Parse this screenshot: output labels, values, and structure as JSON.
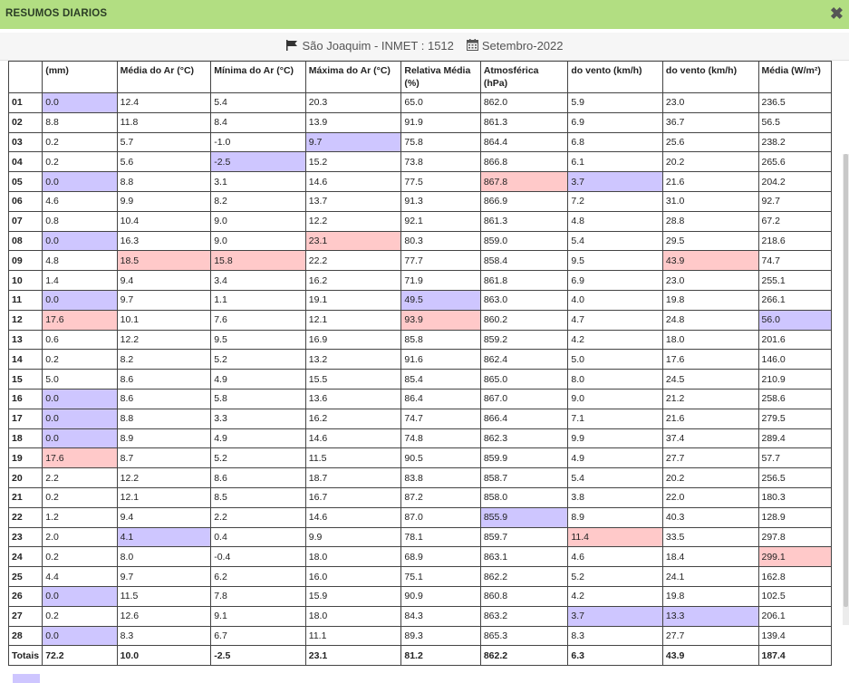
{
  "window": {
    "title": "RESUMOS DIARIOS",
    "close_icon": "close-icon"
  },
  "header": {
    "station": "São Joaquim - INMET : 1512",
    "period": "Setembro-2022",
    "station_icon": "flag-icon",
    "period_icon": "calendar-icon"
  },
  "colors": {
    "title_bar": "#b2de82",
    "min_highlight": "#cec6ff",
    "max_highlight": "#ffc9c9"
  },
  "table": {
    "columns": [
      "",
      "(mm)",
      "Média do Ar (°C)",
      "Mínima do Ar (°C)",
      "Máxima do Ar (°C)",
      "Relativa Média (%)",
      "Atmosférica (hPa)",
      "do vento (km/h)",
      "do vento (km/h)",
      "Média (W/m²)"
    ],
    "rows": [
      {
        "day": "01",
        "cells": [
          "0.0",
          "12.4",
          "5.4",
          "20.3",
          "65.0",
          "862.0",
          "5.9",
          "23.0",
          "236.5"
        ],
        "hl": [
          "min",
          "",
          "",
          "",
          "",
          "",
          "",
          "",
          ""
        ]
      },
      {
        "day": "02",
        "cells": [
          "8.8",
          "11.8",
          "8.4",
          "13.9",
          "91.9",
          "861.3",
          "6.9",
          "36.7",
          "56.5"
        ],
        "hl": [
          "",
          "",
          "",
          "",
          "",
          "",
          "",
          "",
          ""
        ]
      },
      {
        "day": "03",
        "cells": [
          "0.2",
          "5.7",
          "-1.0",
          "9.7",
          "75.8",
          "864.4",
          "6.8",
          "25.6",
          "238.2"
        ],
        "hl": [
          "",
          "",
          "",
          "min",
          "",
          "",
          "",
          "",
          ""
        ]
      },
      {
        "day": "04",
        "cells": [
          "0.2",
          "5.6",
          "-2.5",
          "15.2",
          "73.8",
          "866.8",
          "6.1",
          "20.2",
          "265.6"
        ],
        "hl": [
          "",
          "",
          "min",
          "",
          "",
          "",
          "",
          "",
          ""
        ]
      },
      {
        "day": "05",
        "cells": [
          "0.0",
          "8.8",
          "3.1",
          "14.6",
          "77.5",
          "867.8",
          "3.7",
          "21.6",
          "204.2"
        ],
        "hl": [
          "min",
          "",
          "",
          "",
          "",
          "max",
          "min",
          "",
          ""
        ]
      },
      {
        "day": "06",
        "cells": [
          "4.6",
          "9.9",
          "8.2",
          "13.7",
          "91.3",
          "866.9",
          "7.2",
          "31.0",
          "92.7"
        ],
        "hl": [
          "",
          "",
          "",
          "",
          "",
          "",
          "",
          "",
          ""
        ]
      },
      {
        "day": "07",
        "cells": [
          "0.8",
          "10.4",
          "9.0",
          "12.2",
          "92.1",
          "861.3",
          "4.8",
          "28.8",
          "67.2"
        ],
        "hl": [
          "",
          "",
          "",
          "",
          "",
          "",
          "",
          "",
          ""
        ]
      },
      {
        "day": "08",
        "cells": [
          "0.0",
          "16.3",
          "9.0",
          "23.1",
          "80.3",
          "859.0",
          "5.4",
          "29.5",
          "218.6"
        ],
        "hl": [
          "min",
          "",
          "",
          "max",
          "",
          "",
          "",
          "",
          ""
        ]
      },
      {
        "day": "09",
        "cells": [
          "4.8",
          "18.5",
          "15.8",
          "22.2",
          "77.7",
          "858.4",
          "9.5",
          "43.9",
          "74.7"
        ],
        "hl": [
          "",
          "max",
          "max",
          "",
          "",
          "",
          "",
          "max",
          ""
        ]
      },
      {
        "day": "10",
        "cells": [
          "1.4",
          "9.4",
          "3.4",
          "16.2",
          "71.9",
          "861.8",
          "6.9",
          "23.0",
          "255.1"
        ],
        "hl": [
          "",
          "",
          "",
          "",
          "",
          "",
          "",
          "",
          ""
        ]
      },
      {
        "day": "11",
        "cells": [
          "0.0",
          "9.7",
          "1.1",
          "19.1",
          "49.5",
          "863.0",
          "4.0",
          "19.8",
          "266.1"
        ],
        "hl": [
          "min",
          "",
          "",
          "",
          "min",
          "",
          "",
          "",
          ""
        ]
      },
      {
        "day": "12",
        "cells": [
          "17.6",
          "10.1",
          "7.6",
          "12.1",
          "93.9",
          "860.2",
          "4.7",
          "24.8",
          "56.0"
        ],
        "hl": [
          "max",
          "",
          "",
          "",
          "max",
          "",
          "",
          "",
          "min"
        ]
      },
      {
        "day": "13",
        "cells": [
          "0.6",
          "12.2",
          "9.5",
          "16.9",
          "85.8",
          "859.2",
          "4.2",
          "18.0",
          "201.6"
        ],
        "hl": [
          "",
          "",
          "",
          "",
          "",
          "",
          "",
          "",
          ""
        ]
      },
      {
        "day": "14",
        "cells": [
          "0.2",
          "8.2",
          "5.2",
          "13.2",
          "91.6",
          "862.4",
          "5.0",
          "17.6",
          "146.0"
        ],
        "hl": [
          "",
          "",
          "",
          "",
          "",
          "",
          "",
          "",
          ""
        ]
      },
      {
        "day": "15",
        "cells": [
          "5.0",
          "8.6",
          "4.9",
          "15.5",
          "85.4",
          "865.0",
          "8.0",
          "24.5",
          "210.9"
        ],
        "hl": [
          "",
          "",
          "",
          "",
          "",
          "",
          "",
          "",
          ""
        ]
      },
      {
        "day": "16",
        "cells": [
          "0.0",
          "8.6",
          "5.8",
          "13.6",
          "86.4",
          "867.0",
          "9.0",
          "21.2",
          "258.6"
        ],
        "hl": [
          "min",
          "",
          "",
          "",
          "",
          "",
          "",
          "",
          ""
        ]
      },
      {
        "day": "17",
        "cells": [
          "0.0",
          "8.8",
          "3.3",
          "16.2",
          "74.7",
          "866.4",
          "7.1",
          "21.6",
          "279.5"
        ],
        "hl": [
          "min",
          "",
          "",
          "",
          "",
          "",
          "",
          "",
          ""
        ]
      },
      {
        "day": "18",
        "cells": [
          "0.0",
          "8.9",
          "4.9",
          "14.6",
          "74.8",
          "862.3",
          "9.9",
          "37.4",
          "289.4"
        ],
        "hl": [
          "min",
          "",
          "",
          "",
          "",
          "",
          "",
          "",
          ""
        ]
      },
      {
        "day": "19",
        "cells": [
          "17.6",
          "8.7",
          "5.2",
          "11.5",
          "90.5",
          "859.9",
          "4.9",
          "27.7",
          "57.7"
        ],
        "hl": [
          "max",
          "",
          "",
          "",
          "",
          "",
          "",
          "",
          ""
        ]
      },
      {
        "day": "20",
        "cells": [
          "2.2",
          "12.2",
          "8.6",
          "18.7",
          "83.8",
          "858.7",
          "5.4",
          "20.2",
          "256.5"
        ],
        "hl": [
          "",
          "",
          "",
          "",
          "",
          "",
          "",
          "",
          ""
        ]
      },
      {
        "day": "21",
        "cells": [
          "0.2",
          "12.1",
          "8.5",
          "16.7",
          "87.2",
          "858.0",
          "3.8",
          "22.0",
          "180.3"
        ],
        "hl": [
          "",
          "",
          "",
          "",
          "",
          "",
          "",
          "",
          ""
        ]
      },
      {
        "day": "22",
        "cells": [
          "1.2",
          "9.4",
          "2.2",
          "14.6",
          "87.0",
          "855.9",
          "8.9",
          "40.3",
          "128.9"
        ],
        "hl": [
          "",
          "",
          "",
          "",
          "",
          "min",
          "",
          "",
          ""
        ]
      },
      {
        "day": "23",
        "cells": [
          "2.0",
          "4.1",
          "0.4",
          "9.9",
          "78.1",
          "859.7",
          "11.4",
          "33.5",
          "297.8"
        ],
        "hl": [
          "",
          "min",
          "",
          "",
          "",
          "",
          "max",
          "",
          ""
        ]
      },
      {
        "day": "24",
        "cells": [
          "0.2",
          "8.0",
          "-0.4",
          "18.0",
          "68.9",
          "863.1",
          "4.6",
          "18.4",
          "299.1"
        ],
        "hl": [
          "",
          "",
          "",
          "",
          "",
          "",
          "",
          "",
          "max"
        ]
      },
      {
        "day": "25",
        "cells": [
          "4.4",
          "9.7",
          "6.2",
          "16.0",
          "75.1",
          "862.2",
          "5.2",
          "24.1",
          "162.8"
        ],
        "hl": [
          "",
          "",
          "",
          "",
          "",
          "",
          "",
          "",
          ""
        ]
      },
      {
        "day": "26",
        "cells": [
          "0.0",
          "11.5",
          "7.8",
          "15.9",
          "90.9",
          "860.8",
          "4.2",
          "19.8",
          "102.5"
        ],
        "hl": [
          "min",
          "",
          "",
          "",
          "",
          "",
          "",
          "",
          ""
        ]
      },
      {
        "day": "27",
        "cells": [
          "0.2",
          "12.6",
          "9.1",
          "18.0",
          "84.3",
          "863.2",
          "3.7",
          "13.3",
          "206.1"
        ],
        "hl": [
          "",
          "",
          "",
          "",
          "",
          "",
          "min",
          "min",
          ""
        ]
      },
      {
        "day": "28",
        "cells": [
          "0.0",
          "8.3",
          "6.7",
          "11.1",
          "89.3",
          "865.3",
          "8.3",
          "27.7",
          "139.4"
        ],
        "hl": [
          "min",
          "",
          "",
          "",
          "",
          "",
          "",
          "",
          ""
        ]
      }
    ],
    "totals": {
      "label": "Totais",
      "cells": [
        "72.2",
        "10.0",
        "-2.5",
        "23.1",
        "81.2",
        "862.2",
        "6.3",
        "43.9",
        "187.4"
      ]
    }
  }
}
